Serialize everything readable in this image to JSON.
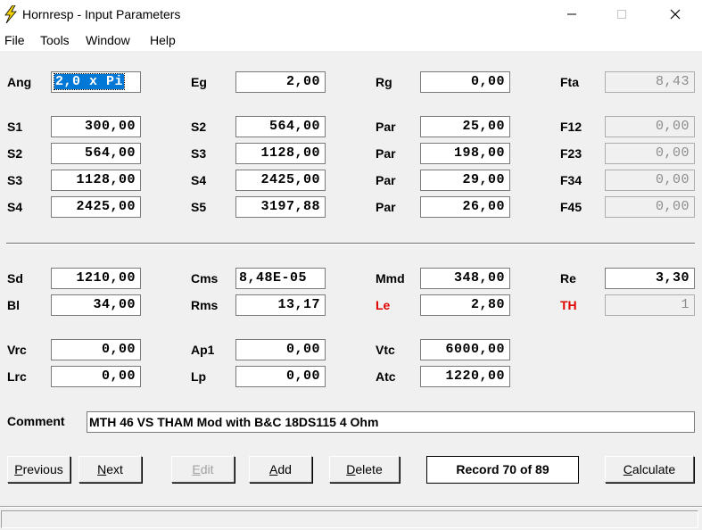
{
  "window": {
    "title": "Hornresp - Input Parameters",
    "icon": "lightning-icon"
  },
  "menu": [
    "File",
    "Tools",
    "Window",
    "Help"
  ],
  "params": {
    "ang": {
      "label": "Ang",
      "value": "2,0 x Pi"
    },
    "eg": {
      "label": "Eg",
      "value": "2,00"
    },
    "rg": {
      "label": "Rg",
      "value": "0,00"
    },
    "fta": {
      "label": "Fta",
      "value": "8,43"
    },
    "rows": [
      {
        "s_label": "S1",
        "s_val": "300,00",
        "s2_label": "S2",
        "s2_val": "564,00",
        "par_label": "Par",
        "par_val": "25,00",
        "f_label": "F12",
        "f_val": "0,00"
      },
      {
        "s_label": "S2",
        "s_val": "564,00",
        "s2_label": "S3",
        "s2_val": "1128,00",
        "par_label": "Par",
        "par_val": "198,00",
        "f_label": "F23",
        "f_val": "0,00"
      },
      {
        "s_label": "S3",
        "s_val": "1128,00",
        "s2_label": "S4",
        "s2_val": "2425,00",
        "par_label": "Par",
        "par_val": "29,00",
        "f_label": "F34",
        "f_val": "0,00"
      },
      {
        "s_label": "S4",
        "s_val": "2425,00",
        "s2_label": "S5",
        "s2_val": "3197,88",
        "par_label": "Par",
        "par_val": "26,00",
        "f_label": "F45",
        "f_val": "0,00"
      }
    ],
    "sd": {
      "label": "Sd",
      "value": "1210,00"
    },
    "cms": {
      "label": "Cms",
      "value": "8,48E-05"
    },
    "mmd": {
      "label": "Mmd",
      "value": "348,00"
    },
    "re": {
      "label": "Re",
      "value": "3,30"
    },
    "bl": {
      "label": "Bl",
      "value": "34,00"
    },
    "rms": {
      "label": "Rms",
      "value": "13,17"
    },
    "le": {
      "label": "Le",
      "value": "2,80"
    },
    "th": {
      "label": "TH",
      "value": "1"
    },
    "vrc": {
      "label": "Vrc",
      "value": "0,00"
    },
    "ap1": {
      "label": "Ap1",
      "value": "0,00"
    },
    "vtc": {
      "label": "Vtc",
      "value": "6000,00"
    },
    "lrc": {
      "label": "Lrc",
      "value": "0,00"
    },
    "lp": {
      "label": "Lp",
      "value": "0,00"
    },
    "atc": {
      "label": "Atc",
      "value": "1220,00"
    }
  },
  "comment": {
    "label": "Comment",
    "value": "MTH 46 VS THAM Mod with B&C 18DS115 4 Ohm"
  },
  "buttons": {
    "previous_first": "P",
    "previous_rest": "revious",
    "next_first": "N",
    "next_rest": "ext",
    "edit_first": "E",
    "edit_rest": "dit",
    "add_first": "A",
    "add_rest": "dd",
    "delete_first": "D",
    "delete_rest": "elete",
    "calculate_first": "C",
    "calculate_rest": "alculate"
  },
  "record": "Record 70 of 89",
  "colors": {
    "accent_red": "#e00000",
    "selection": "#0078d7",
    "lightning": "#f0d000"
  }
}
